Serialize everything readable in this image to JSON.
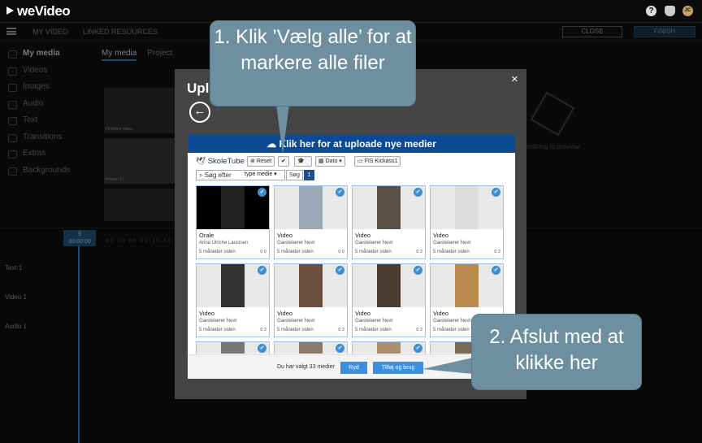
{
  "app": {
    "logo": "weVideo"
  },
  "topbar": {
    "help_icon": "?",
    "avatar_initials": "JC"
  },
  "secbar": {
    "my_video": "MY VIDEO",
    "linked_resources": "LINKED RESOURCES",
    "close": "CLOSE",
    "finish": "FINISH"
  },
  "sidebar": {
    "items": [
      {
        "label": "My media",
        "icon": "folder-icon"
      },
      {
        "label": "Videos",
        "icon": "film-icon"
      },
      {
        "label": "Images",
        "icon": "image-icon"
      },
      {
        "label": "Audio",
        "icon": "music-icon"
      },
      {
        "label": "Text",
        "icon": "text-icon"
      },
      {
        "label": "Transitions",
        "icon": "transition-icon"
      },
      {
        "label": "Extras",
        "icon": "extras-icon"
      },
      {
        "label": "Backgrounds",
        "icon": "background-icon"
      }
    ]
  },
  "media_tabs": {
    "my_media": "My media",
    "project": "Project"
  },
  "media_thumbs": {
    "first_caption": "Finished Video",
    "second_caption": "Person 17",
    "time1": "00:05",
    "time2": "00:13"
  },
  "preview": {
    "text": "nothing to preview"
  },
  "timeline": {
    "playhead_num": "9",
    "playhead_time": "00:00:00",
    "tracks": [
      "Text 1",
      "Video 1",
      "Audio 1"
    ],
    "ruler": "00:10:00   00:20:00   00:30:00"
  },
  "modal": {
    "title": "Upl",
    "close": "×",
    "banner": "Klik her for at uploade nye medier",
    "brand": "SkoleTube",
    "toolbar": {
      "reset": "Reset",
      "dato": "Dato",
      "group": "FIS Kickass1"
    },
    "search_placeholder": "Søg efter",
    "type_filter": "type medie ▾",
    "search_btn": "Søg",
    "page": "1",
    "cards": [
      {
        "title": "Orale",
        "author": "Anna Ulriche Laustsen",
        "age": "5 måneder siden",
        "stats": "0 0"
      },
      {
        "title": "Video",
        "author": "Gæstelærer Next",
        "age": "5 måneder siden",
        "stats": "0 0"
      },
      {
        "title": "Video",
        "author": "Gæstelærer Next",
        "age": "5 måneder siden",
        "stats": "0 2"
      },
      {
        "title": "Video",
        "author": "Gæstelærer Next",
        "age": "5 måneder siden",
        "stats": "0 2"
      },
      {
        "title": "Video",
        "author": "Gæstelærer Next",
        "age": "5 måneder siden",
        "stats": "0 2"
      },
      {
        "title": "Video",
        "author": "Gæstelærer Next",
        "age": "5 måneder siden",
        "stats": "0 2"
      },
      {
        "title": "Video",
        "author": "Gæstelærer Next",
        "age": "5 måneder siden",
        "stats": "0 2"
      },
      {
        "title": "Video",
        "author": "Gæstelærer Next",
        "age": "5 måneder siden",
        "stats": "0 2"
      },
      {
        "title": "",
        "author": "",
        "age": "",
        "stats": ""
      },
      {
        "title": "",
        "author": "",
        "age": "",
        "stats": ""
      },
      {
        "title": "",
        "author": "",
        "age": "",
        "stats": ""
      },
      {
        "title": "",
        "author": "",
        "age": "",
        "stats": ""
      }
    ],
    "footer": {
      "selected": "Du har valgt 33 medier",
      "clear": "Ryd",
      "add": "Tilføj og brug"
    }
  },
  "callouts": {
    "one": "1. Klik ’Vælg alle’ for at markere alle filer",
    "two": "2. Afslut med at klikke her"
  },
  "colors": {
    "banner": "#0d4a94",
    "button": "#3b8fdc",
    "callout": "#6e8fa0"
  }
}
